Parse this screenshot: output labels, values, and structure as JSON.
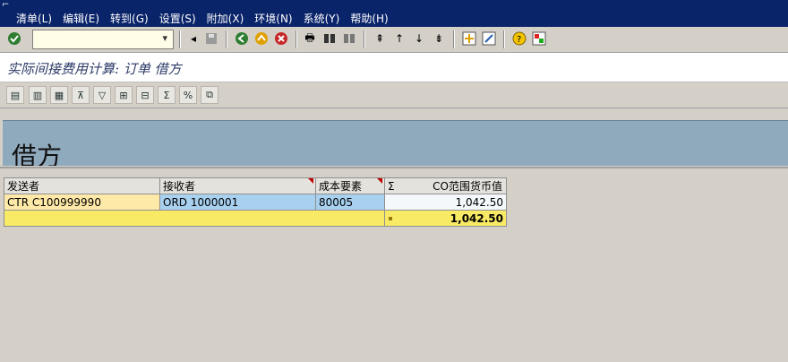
{
  "menubar": {
    "items": [
      "清单(L)",
      "编辑(E)",
      "转到(G)",
      "设置(S)",
      "附加(X)",
      "环境(N)",
      "系统(Y)",
      "帮助(H)"
    ]
  },
  "toolbar": {
    "command_value": "",
    "icons": [
      "check-icon",
      "back-icon",
      "exit-icon",
      "cancel-icon",
      "print-icon",
      "find-icon",
      "find-next-icon",
      "first-page-icon",
      "prev-page-icon",
      "next-page-icon",
      "last-page-icon",
      "new-session-icon",
      "shortcut-icon",
      "help-icon",
      "customize-layout-icon"
    ]
  },
  "title": "实际间接费用计算: 订单 借方",
  "header": {
    "text": "借方"
  },
  "grid": {
    "columns": [
      "发送者",
      "接收者",
      "成本要素",
      "Σ",
      "CO范围货币值"
    ],
    "rows": [
      {
        "sender": "CTR C100999990",
        "receiver": "ORD 1000001",
        "cost_element": "80005",
        "amount": "1,042.50"
      }
    ],
    "total": {
      "amount": "1,042.50"
    }
  }
}
